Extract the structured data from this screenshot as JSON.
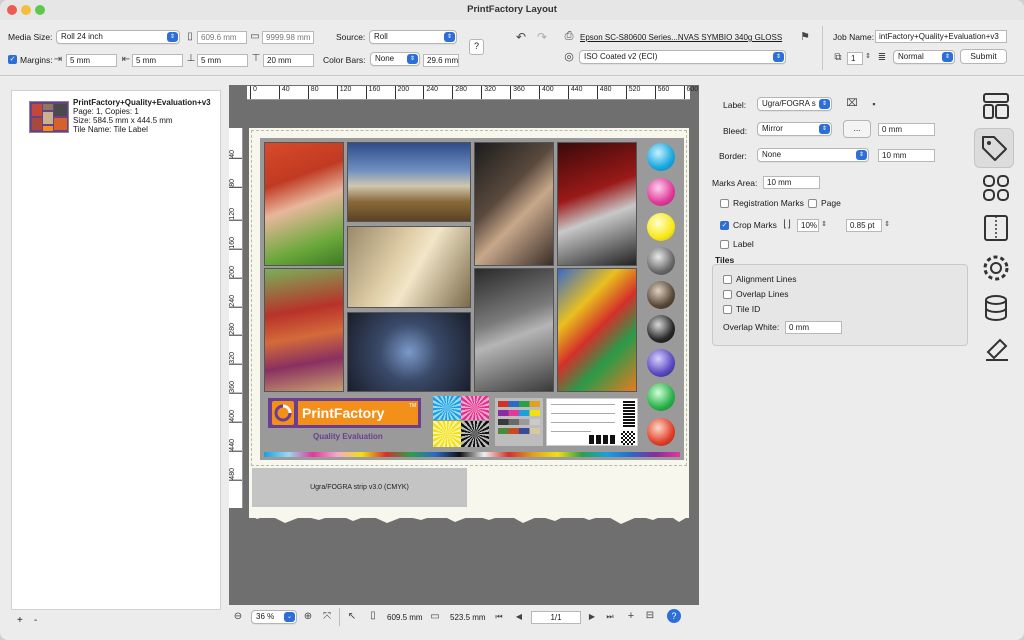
{
  "window": {
    "title": "PrintFactory Layout"
  },
  "toolbar": {
    "media_size_label": "Media Size:",
    "media_size_value": "Roll 24 inch",
    "width_value": "609.6 mm",
    "height_value": "9999.98 mm",
    "margins_label": "Margins:",
    "margin_top": "5 mm",
    "margin_left": "5 mm",
    "margin_bottom": "5 mm",
    "margin_right": "20 mm",
    "source_label": "Source:",
    "source_value": "Roll",
    "color_bars_label": "Color Bars:",
    "color_bars_value": "None",
    "color_bars_size": "29.6 mm",
    "printer_name": "Epson SC-S80600 Series...NVAS SYMBIO 340g GLOSS",
    "profile_value": "ISO Coated v2 (ECI)",
    "job_name_label": "Job Name:",
    "job_name_value": "intFactory+Quality+Evaluation+v3",
    "copies_value": "1",
    "priority_value": "Normal",
    "submit_label": "Submit"
  },
  "job_list": {
    "item": {
      "name": "PrintFactory+Quality+Evaluation+v3",
      "page": "Page: 1, Copies: 1",
      "size": "Size: 584.5 mm x 444.5 mm",
      "tile": "Tile Name: Tile Label"
    },
    "add_label": "+",
    "remove_label": "-"
  },
  "ruler": {
    "h_ticks": [
      "0",
      "40",
      "80",
      "120",
      "160",
      "200",
      "240",
      "280",
      "320",
      "360",
      "400",
      "440",
      "480",
      "520",
      "560",
      "600"
    ],
    "v_ticks": [
      "40",
      "80",
      "120",
      "160",
      "200",
      "240",
      "280",
      "320",
      "360",
      "400",
      "440",
      "480"
    ]
  },
  "canvas": {
    "logo_text": "PrintFactory",
    "logo_tm": "TM",
    "logo_sub": "Quality Evaluation",
    "strip_label": "Ugra/FOGRA strip v3.0 (CMYK)"
  },
  "right_panel": {
    "label_label": "Label:",
    "label_value": "Ugra/FOGRA s",
    "bleed_label": "Bleed:",
    "bleed_value": "Mirror",
    "bleed_button": "...",
    "bleed_size": "0 mm",
    "border_label": "Border:",
    "border_value": "None",
    "border_size": "10 mm",
    "marks_area_label": "Marks Area:",
    "marks_area_value": "10 mm",
    "registration_marks": "Registration Marks",
    "page_label": "Page",
    "crop_marks": "Crop Marks",
    "crop_percent": "10%",
    "crop_pt": "0.85 pt",
    "label_check": "Label",
    "tiles_header": "Tiles",
    "alignment_lines": "Alignment Lines",
    "overlap_lines": "Overlap Lines",
    "tile_id": "Tile ID",
    "overlap_white_label": "Overlap White:",
    "overlap_white_value": "0 mm"
  },
  "bottom_bar": {
    "zoom_value": "36 %",
    "width_value": "609.5 mm",
    "height_value": "523.5 mm",
    "page_value": "1/1",
    "add_label": "+"
  },
  "colors": {
    "accent": "#2d6fd6",
    "canvas_bg": "#6f6f6f",
    "logo_orange": "#f39019",
    "logo_purple": "#6b3e8f"
  }
}
